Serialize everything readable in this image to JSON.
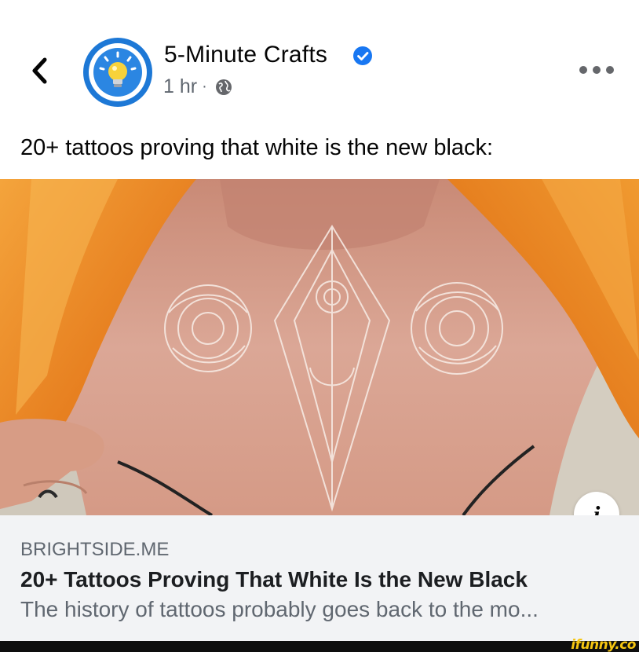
{
  "header": {
    "back_icon": "chevron-left-icon",
    "page_name": "5-Minute Crafts",
    "verified_icon": "verified-badge-icon",
    "time": "1 hr",
    "separator": "·",
    "audience_icon": "globe-icon",
    "more_icon": "more-horizontal-icon"
  },
  "post": {
    "text": "20+ tattoos proving that white is the new black:"
  },
  "link_card": {
    "domain": "BRIGHTSIDE.ME",
    "title": "20+ Tattoos Proving That White Is the New Black",
    "description": "The history of tattoos probably goes back to the mo...",
    "info_icon": "info-icon",
    "info_label": "i"
  },
  "watermark": {
    "text": "ifunny.co"
  },
  "colors": {
    "brand_blue": "#1d78d6",
    "verified_blue": "#1877f2",
    "link_card_bg": "#f2f3f5",
    "meta_gray": "#606770",
    "watermark_yellow": "#f6c611"
  }
}
